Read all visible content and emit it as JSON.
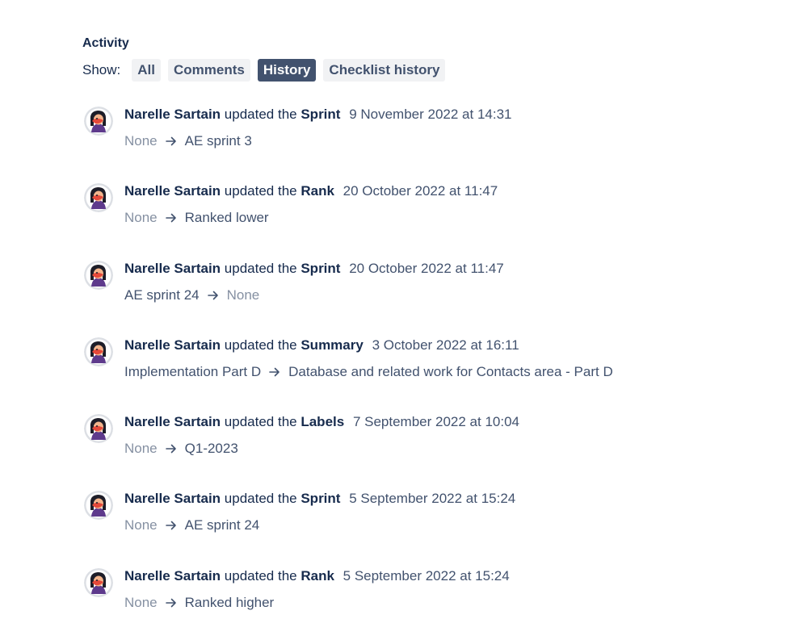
{
  "activity": {
    "title": "Activity",
    "show_label": "Show:",
    "filters": [
      {
        "label": "All",
        "active": false
      },
      {
        "label": "Comments",
        "active": false
      },
      {
        "label": "History",
        "active": true
      },
      {
        "label": "Checklist history",
        "active": false
      }
    ]
  },
  "colors": {
    "active_filter_bg": "#42526e",
    "inactive_filter_bg": "#f1f2f4",
    "text_primary": "#172b4d",
    "text_secondary": "#42526e",
    "text_none": "#8590a2"
  },
  "entries": [
    {
      "author": "Narelle Sartain",
      "action": "updated the",
      "field": "Sprint",
      "date": "9 November 2022 at 14:31",
      "from": "None",
      "to": "AE sprint 3",
      "from_is_none": true,
      "to_is_none": false
    },
    {
      "author": "Narelle Sartain",
      "action": "updated the",
      "field": "Rank",
      "date": "20 October 2022 at 11:47",
      "from": "None",
      "to": "Ranked lower",
      "from_is_none": true,
      "to_is_none": false
    },
    {
      "author": "Narelle Sartain",
      "action": "updated the",
      "field": "Sprint",
      "date": "20 October 2022 at 11:47",
      "from": "AE sprint 24",
      "to": "None",
      "from_is_none": false,
      "to_is_none": true
    },
    {
      "author": "Narelle Sartain",
      "action": "updated the",
      "field": "Summary",
      "date": "3 October 2022 at 16:11",
      "from": "Implementation Part D",
      "to": "Database and related work for Contacts area - Part D",
      "from_is_none": false,
      "to_is_none": false
    },
    {
      "author": "Narelle Sartain",
      "action": "updated the",
      "field": "Labels",
      "date": "7 September 2022 at 10:04",
      "from": "None",
      "to": "Q1-2023",
      "from_is_none": true,
      "to_is_none": false
    },
    {
      "author": "Narelle Sartain",
      "action": "updated the",
      "field": "Sprint",
      "date": "5 September 2022 at 15:24",
      "from": "None",
      "to": "AE sprint 24",
      "from_is_none": true,
      "to_is_none": false
    },
    {
      "author": "Narelle Sartain",
      "action": "updated the",
      "field": "Rank",
      "date": "5 September 2022 at 15:24",
      "from": "None",
      "to": "Ranked higher",
      "from_is_none": true,
      "to_is_none": false
    }
  ],
  "icons": {
    "avatar": "user-avatar-icon",
    "arrow": "arrow-right-icon"
  }
}
